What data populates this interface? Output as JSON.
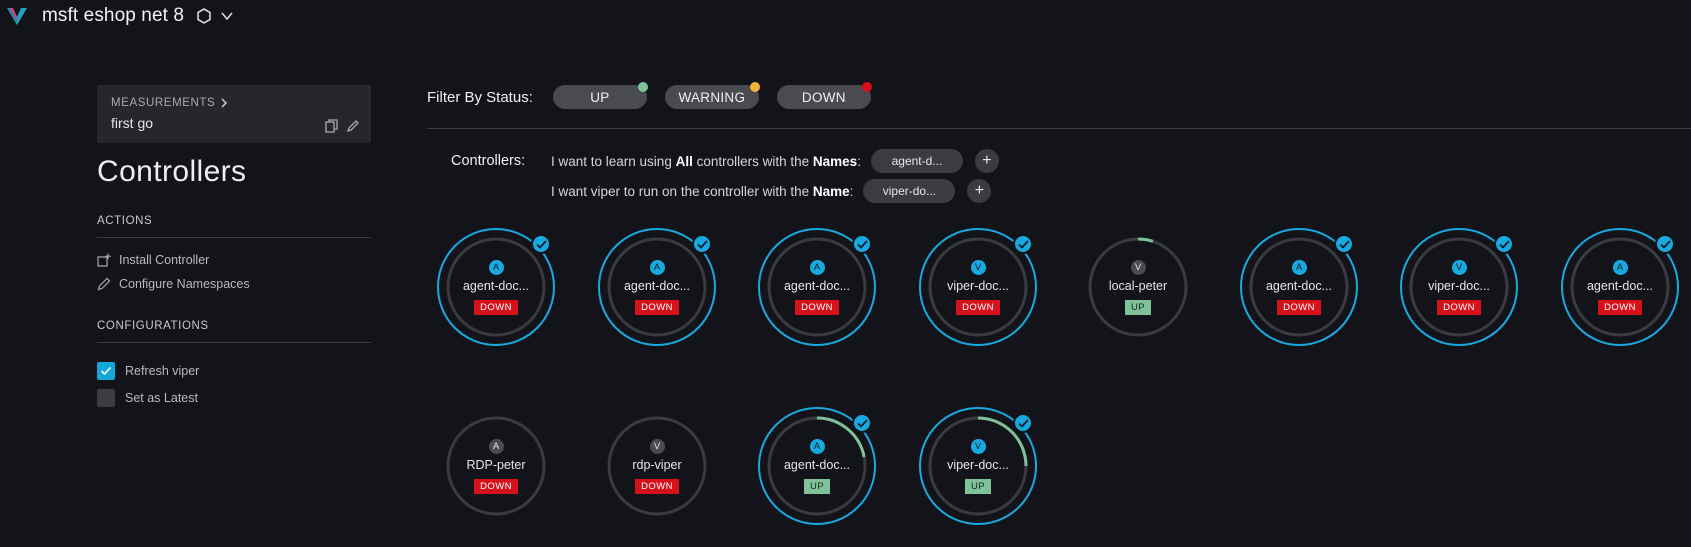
{
  "header": {
    "title": "msft eshop net 8",
    "logo_icon": "v-logo-icon",
    "context_icon": "hexagon-icon",
    "menu_icon": "chevron-down-icon"
  },
  "sidebar": {
    "measurements_label": "MEASUREMENTS",
    "measurement_name": "first go",
    "page_title": "Controllers",
    "actions_title": "ACTIONS",
    "actions": [
      {
        "label": "Install Controller",
        "icon": "install-icon"
      },
      {
        "label": "Configure Namespaces",
        "icon": "pencil-icon"
      }
    ],
    "configurations_title": "CONFIGURATIONS",
    "configurations": [
      {
        "label": "Refresh viper",
        "checked": true
      },
      {
        "label": "Set as Latest",
        "checked": false
      }
    ]
  },
  "filter": {
    "label": "Filter By Status:",
    "options": [
      {
        "label": "UP",
        "dot_color": "#7fc29a"
      },
      {
        "label": "WARNING",
        "dot_color": "#f0b43c"
      },
      {
        "label": "DOWN",
        "dot_color": "#d6111b"
      }
    ]
  },
  "controllers": {
    "label": "Controllers:",
    "line1": {
      "prefix": "I want to learn using ",
      "bold1": "All",
      "middle": " controllers with the ",
      "bold2": "Names",
      "suffix": ":",
      "chip": "agent-d..."
    },
    "line2": {
      "prefix": "I want viper to run on the controller with the ",
      "bold": "Name",
      "suffix": ":",
      "chip": "viper-do..."
    }
  },
  "nodes": [
    {
      "type": "A",
      "name": "agent-doc...",
      "status": "DOWN",
      "selected": true,
      "progress": null
    },
    {
      "type": "A",
      "name": "agent-doc...",
      "status": "DOWN",
      "selected": true,
      "progress": null
    },
    {
      "type": "A",
      "name": "agent-doc...",
      "status": "DOWN",
      "selected": true,
      "progress": null
    },
    {
      "type": "V",
      "name": "viper-doc...",
      "status": "DOWN",
      "selected": true,
      "progress": null
    },
    {
      "type": "V",
      "name": "local-peter",
      "status": "UP",
      "selected": false,
      "progress": 0.05
    },
    {
      "type": "A",
      "name": "agent-doc...",
      "status": "DOWN",
      "selected": true,
      "progress": null
    },
    {
      "type": "V",
      "name": "viper-doc...",
      "status": "DOWN",
      "selected": true,
      "progress": null
    },
    {
      "type": "A",
      "name": "agent-doc...",
      "status": "DOWN",
      "selected": true,
      "progress": null
    },
    {
      "type": "A",
      "name": "RDP-peter",
      "status": "DOWN",
      "selected": false,
      "progress": null
    },
    {
      "type": "V",
      "name": "rdp-viper",
      "status": "DOWN",
      "selected": false,
      "progress": null
    },
    {
      "type": "A",
      "name": "agent-doc...",
      "status": "UP",
      "selected": true,
      "progress": 0.22
    },
    {
      "type": "V",
      "name": "viper-doc...",
      "status": "UP",
      "selected": true,
      "progress": 0.25
    }
  ],
  "colors": {
    "accent": "#18a9e0",
    "up": "#7fc29a",
    "down": "#d6111b",
    "warning": "#f0b43c",
    "background": "#131419"
  }
}
